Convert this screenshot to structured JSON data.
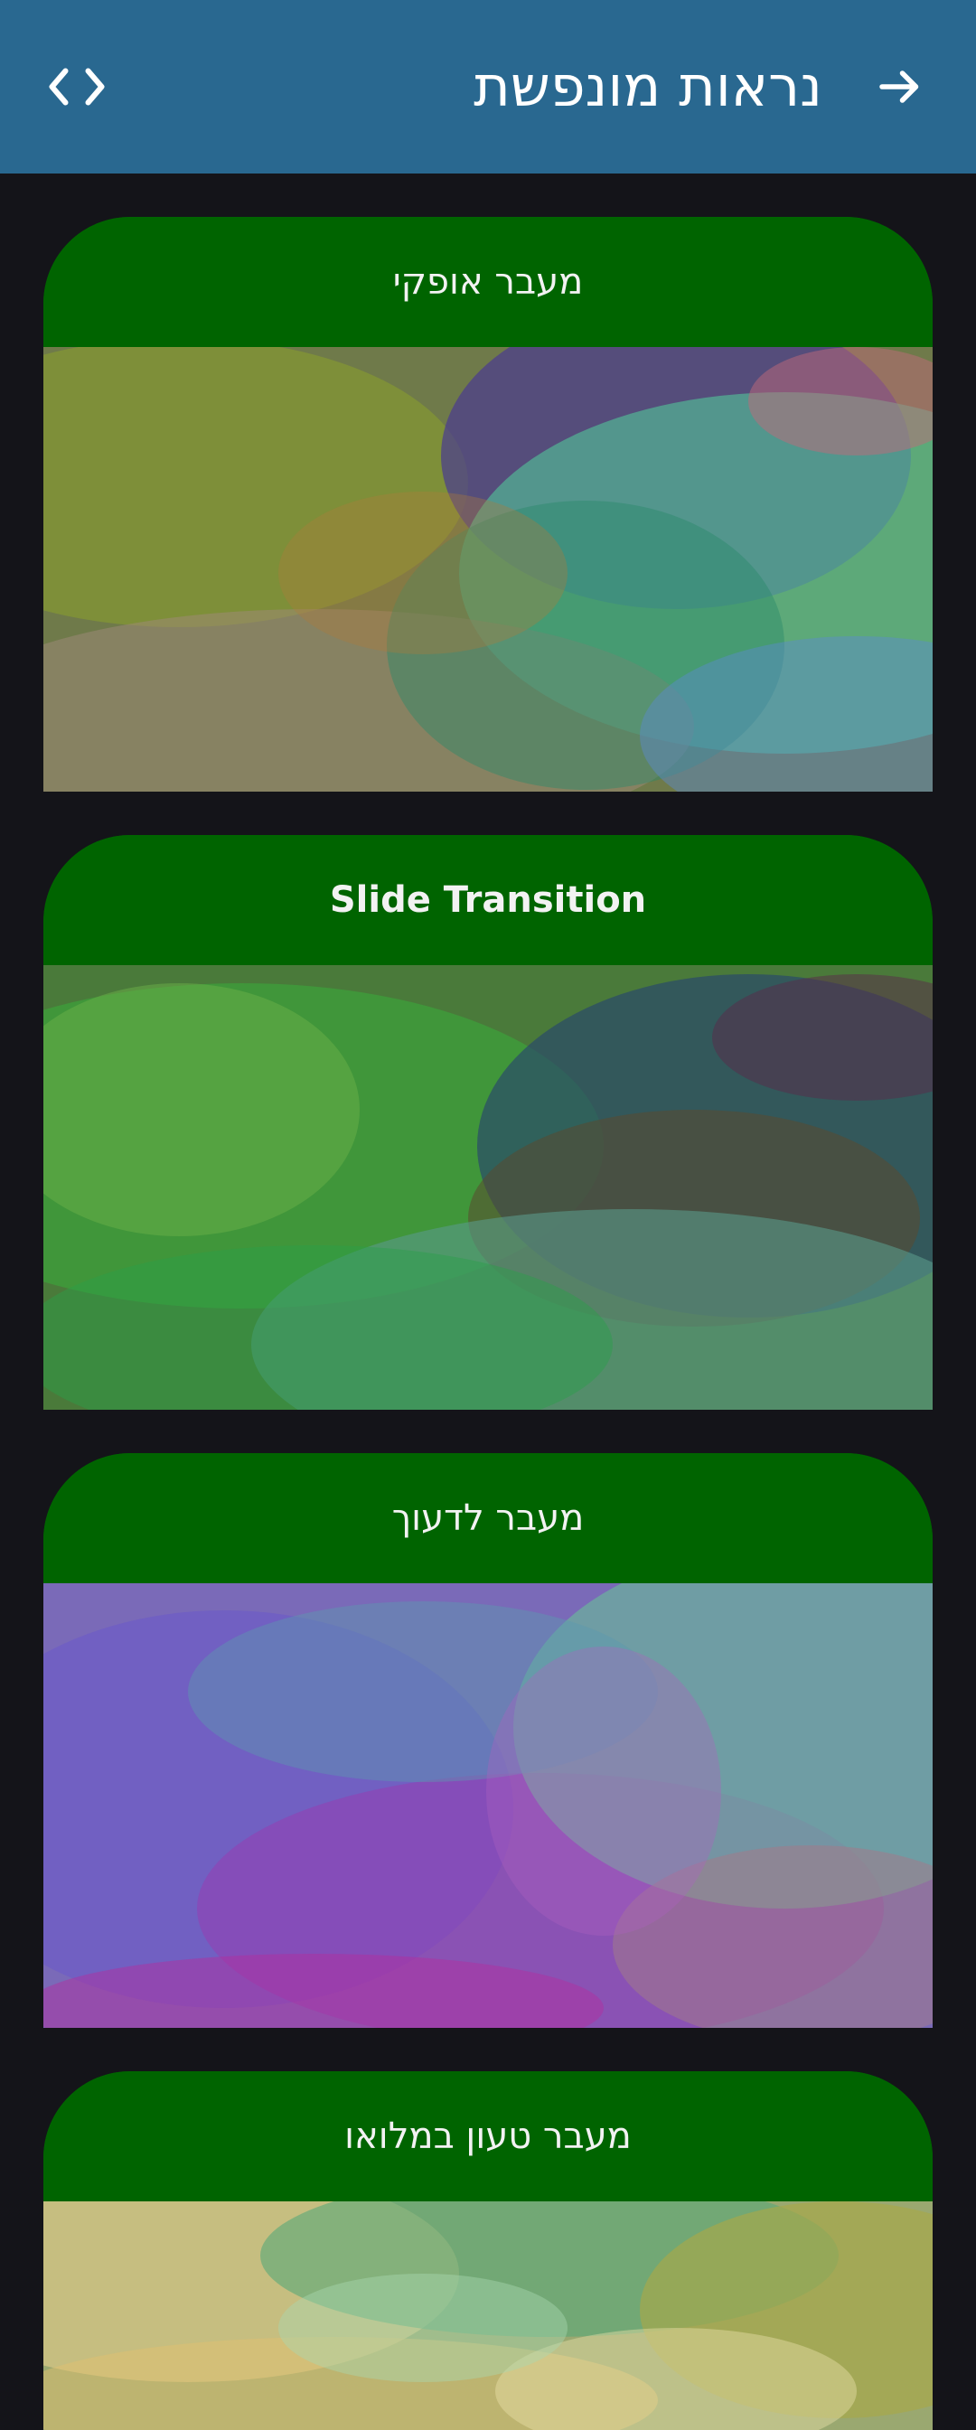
{
  "app_bar": {
    "title": "נראות מונפשת",
    "back_icon": "arrow-right-icon",
    "code_icon": "code-icon"
  },
  "cards": [
    {
      "label": "מעבר אופקי",
      "colors": [
        "#8a9a2c",
        "#4f8a6c",
        "#6a5a8c",
        "#52c89a"
      ]
    },
    {
      "label": "Slide Transition",
      "colors": [
        "#3aa83a",
        "#2e6a3a",
        "#5a4a3a",
        "#2a5a6a"
      ]
    },
    {
      "label": "מעבר לדעוך",
      "colors": [
        "#6a5ac0",
        "#8a4ab0",
        "#6ab89a",
        "#b04ab0"
      ]
    },
    {
      "label": "מעבר טעון במלואו",
      "colors": [
        "#d8c888",
        "#58a878",
        "#a8a848",
        "#e8d890"
      ]
    }
  ]
}
